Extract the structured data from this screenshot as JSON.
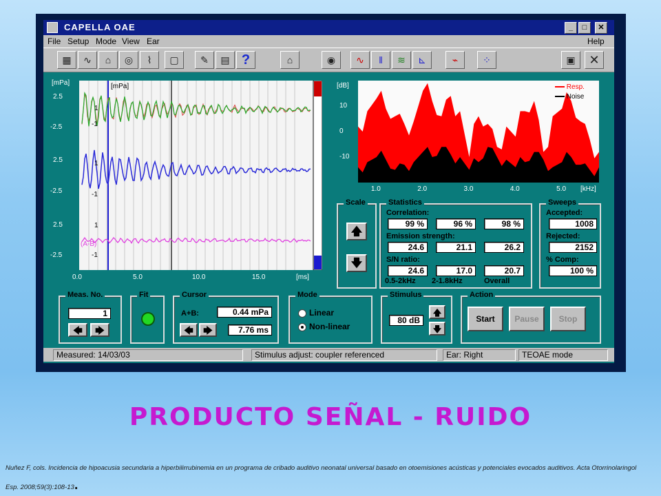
{
  "window": {
    "title": "CAPELLA OAE",
    "menu": [
      "File",
      "Setup",
      "Mode",
      "View",
      "Ear"
    ],
    "help": "Help",
    "window_buttons": [
      "_",
      "□",
      "✕"
    ]
  },
  "toolbar": {
    "icons": [
      "patient-icon",
      "waveform-icon",
      "printer-icon",
      "probe-icon",
      "chart-icon",
      "help-doc-icon",
      "edit-icon",
      "print-icon",
      "question-icon",
      "home-icon",
      "record-icon",
      "wave-icon",
      "bars-icon",
      "multi-chart-icon",
      "spectrum-icon",
      "trace-icon",
      "grid-icon",
      "save-icon",
      "close-icon"
    ],
    "question_glyph": "?"
  },
  "waveform": {
    "unit_left": "[mPa]",
    "unit_inner": "[mPa]",
    "y_ticks": [
      "2.5",
      "-2.5",
      "2.5",
      "-2.5",
      "2.5",
      "-2.5"
    ],
    "inner_ticks": [
      "1",
      "-1",
      "1",
      "-1",
      "1",
      "-1"
    ],
    "x_ticks": [
      "0.0",
      "5.0",
      "10.0",
      "15.0"
    ],
    "x_unit": "[ms]",
    "trace_labels": [
      "(A-B)"
    ],
    "colors": {
      "ab": "#2020d0",
      "top": "#2ea82e",
      "diff": "#e040e0"
    }
  },
  "chart_data": {
    "type": "area",
    "ylabel": "[dB]",
    "xlabel": "[kHz]",
    "x_ticks": [
      "1.0",
      "2.0",
      "3.0",
      "4.0",
      "5.0"
    ],
    "y_ticks": [
      "10",
      "0",
      "-10"
    ],
    "ylim": [
      -20,
      20
    ],
    "xlim": [
      0.6,
      5.8
    ],
    "legend_position": "top-right",
    "series": [
      {
        "name": "Resp.",
        "color": "#ff0000",
        "x": [
          0.6,
          0.8,
          1.0,
          1.2,
          1.4,
          1.6,
          1.8,
          2.0,
          2.2,
          2.4,
          2.6,
          2.8,
          3.0,
          3.2,
          3.4,
          3.6,
          3.8,
          4.0,
          4.2,
          4.4,
          4.6,
          4.8,
          5.0,
          5.2,
          5.4,
          5.6,
          5.8
        ],
        "values": [
          2,
          8,
          13,
          9,
          6,
          3,
          4,
          16,
          12,
          6,
          14,
          8,
          -10,
          6,
          3,
          -6,
          2,
          -2,
          8,
          12,
          -8,
          6,
          9,
          12,
          4,
          -3,
          -8
        ]
      },
      {
        "name": "Noise",
        "color": "#000000",
        "x": [
          0.6,
          0.8,
          1.0,
          1.2,
          1.4,
          1.6,
          1.8,
          2.0,
          2.2,
          2.4,
          2.6,
          2.8,
          3.0,
          3.2,
          3.4,
          3.6,
          3.8,
          4.0,
          4.2,
          4.4,
          4.6,
          4.8,
          5.0,
          5.2,
          5.4,
          5.6,
          5.8
        ],
        "values": [
          -14,
          -12,
          -10,
          -11,
          -15,
          -13,
          -12,
          -8,
          -10,
          -6,
          -9,
          -10,
          -15,
          -12,
          -6,
          -10,
          -11,
          -14,
          -12,
          -8,
          -11,
          -14,
          -12,
          -10,
          -13,
          -15,
          -14
        ]
      }
    ]
  },
  "scale": {
    "label": "Scale",
    "up": "🡅",
    "down": "🡇"
  },
  "statistics": {
    "label": "Statistics",
    "correlation_label": "Correlation:",
    "correlation": [
      "99 %",
      "96 %",
      "98 %"
    ],
    "emission_label": "Emission strength:",
    "emission": [
      "24.6",
      "21.1",
      "26.2"
    ],
    "sn_label": "S/N ratio:",
    "sn": [
      "24.6",
      "17.0",
      "20.7"
    ],
    "bands": [
      "0.5-2kHz",
      "2-1.8kHz",
      "Overall"
    ]
  },
  "sweeps": {
    "label": "Sweeps",
    "accepted_label": "Accepted:",
    "accepted": "1008",
    "rejected_label": "Rejected:",
    "rejected": "2152",
    "comp_label": "% Comp:",
    "comp": "100 %"
  },
  "meas": {
    "label": "Meas. No.",
    "value": "1",
    "left": "🡄",
    "right": "🡆"
  },
  "fit": {
    "label": "Fit",
    "color": "#22d822"
  },
  "cursor": {
    "label": "Cursor",
    "ab_label": "A+B:",
    "amplitude": "0.44 mPa",
    "time": "7.76 ms",
    "left": "🡄",
    "right": "🡆"
  },
  "mode": {
    "label": "Mode",
    "options": [
      "Linear",
      "Non-linear"
    ],
    "selected": "Non-linear"
  },
  "stimulus": {
    "label": "Stimulus",
    "value": "80 dB",
    "up": "🡅",
    "down": "🡇"
  },
  "action": {
    "label": "Action",
    "start": "Start",
    "pause": "Pause",
    "stop": "Stop"
  },
  "status": {
    "measured": "Measured: 14/03/03",
    "stimulus": "Stimulus adjust: coupler referenced",
    "ear": "Ear: Right",
    "mode": "TEOAE mode"
  },
  "slide": {
    "heading": "PRODUCTO  SEÑAL - RUIDO",
    "reference": "Nuñez F, cols. Incidencia de hipoacusia secundaria a hiperbilirrubinemia en un programa de cribado auditivo neonatal universal basado en otoemisiones acústicas y potenciales evocados auditivos. Acta Otorrinolaringol Esp. 2008;59(3):108-13",
    "reference_end": "."
  }
}
